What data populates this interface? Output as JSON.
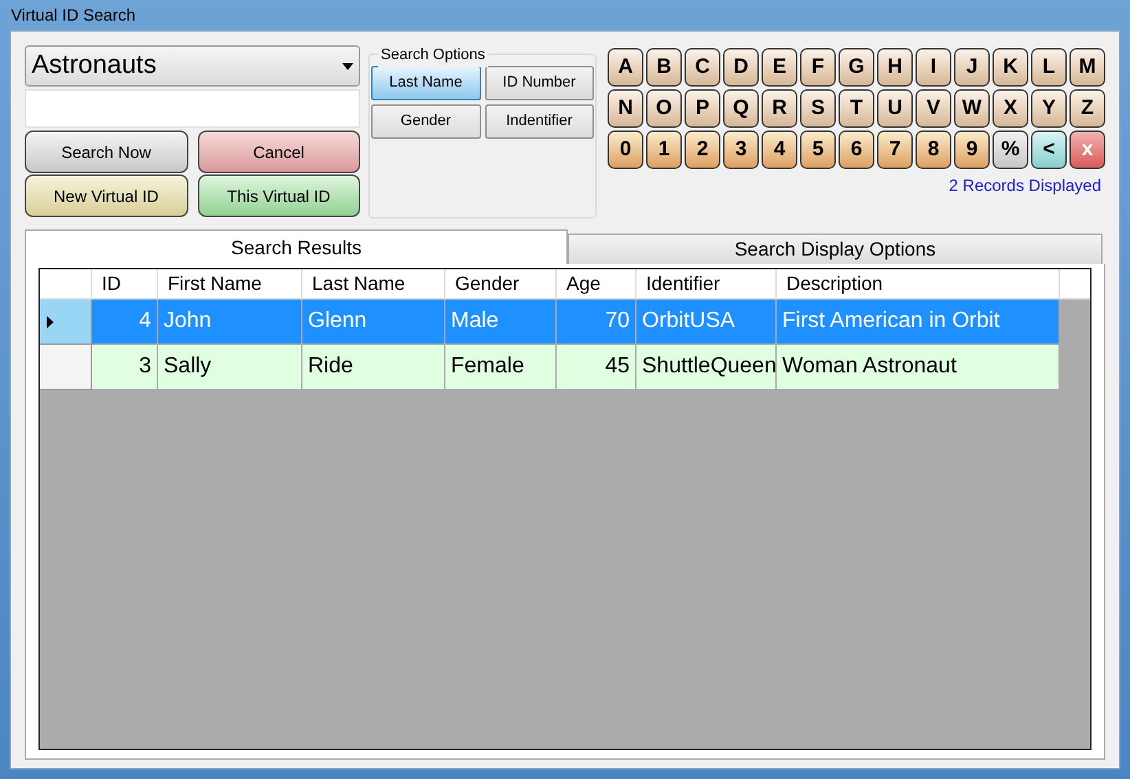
{
  "window": {
    "title": "Virtual ID Search"
  },
  "group": {
    "value": "Astronauts"
  },
  "actions": [
    {
      "label": "Search Now",
      "kind": "gray"
    },
    {
      "label": "Cancel",
      "kind": "red"
    },
    {
      "label": "New Virtual ID",
      "kind": "yellow"
    },
    {
      "label": "This Virtual ID",
      "kind": "green"
    }
  ],
  "search_options": {
    "title": "Search Options",
    "options": [
      {
        "label": "Last Name",
        "selected": true
      },
      {
        "label": "ID Number",
        "selected": false
      },
      {
        "label": "Gender",
        "selected": false
      },
      {
        "label": "Indentifier",
        "selected": false
      }
    ]
  },
  "keypad": [
    {
      "label": "A",
      "kind": "letter"
    },
    {
      "label": "B",
      "kind": "letter"
    },
    {
      "label": "C",
      "kind": "letter"
    },
    {
      "label": "D",
      "kind": "letter"
    },
    {
      "label": "E",
      "kind": "letter"
    },
    {
      "label": "F",
      "kind": "letter"
    },
    {
      "label": "G",
      "kind": "letter"
    },
    {
      "label": "H",
      "kind": "letter"
    },
    {
      "label": "I",
      "kind": "letter"
    },
    {
      "label": "J",
      "kind": "letter"
    },
    {
      "label": "K",
      "kind": "letter"
    },
    {
      "label": "L",
      "kind": "letter"
    },
    {
      "label": "M",
      "kind": "letter"
    },
    {
      "label": "N",
      "kind": "letter"
    },
    {
      "label": "O",
      "kind": "letter"
    },
    {
      "label": "P",
      "kind": "letter"
    },
    {
      "label": "Q",
      "kind": "letter"
    },
    {
      "label": "R",
      "kind": "letter"
    },
    {
      "label": "S",
      "kind": "letter"
    },
    {
      "label": "T",
      "kind": "letter"
    },
    {
      "label": "U",
      "kind": "letter"
    },
    {
      "label": "V",
      "kind": "letter"
    },
    {
      "label": "W",
      "kind": "letter"
    },
    {
      "label": "X",
      "kind": "letter"
    },
    {
      "label": "Y",
      "kind": "letter"
    },
    {
      "label": "Z",
      "kind": "letter"
    },
    {
      "label": "0",
      "kind": "digit"
    },
    {
      "label": "1",
      "kind": "digit"
    },
    {
      "label": "2",
      "kind": "digit"
    },
    {
      "label": "3",
      "kind": "digit"
    },
    {
      "label": "4",
      "kind": "digit"
    },
    {
      "label": "5",
      "kind": "digit"
    },
    {
      "label": "6",
      "kind": "digit"
    },
    {
      "label": "7",
      "kind": "digit"
    },
    {
      "label": "8",
      "kind": "digit"
    },
    {
      "label": "9",
      "kind": "digit"
    },
    {
      "label": "%",
      "kind": "wildcard"
    },
    {
      "label": "<",
      "kind": "backspace"
    },
    {
      "label": "x",
      "kind": "clear"
    }
  ],
  "record_count": "2 Records Displayed",
  "tabs": [
    {
      "label": "Search Results",
      "selected": true
    },
    {
      "label": "Search Display Options",
      "selected": false
    }
  ],
  "table": {
    "columns": [
      "ID",
      "First Name",
      "Last Name",
      "Gender",
      "Age",
      "Identifier",
      "Description"
    ],
    "rows": [
      {
        "selected": true,
        "cells": [
          "4",
          "John",
          "Glenn",
          "Male",
          "70",
          "OrbitUSA",
          "First American in Orbit"
        ]
      },
      {
        "selected": false,
        "cells": [
          "3",
          "Sally",
          "Ride",
          "Female",
          "45",
          "ShuttleQueen",
          "Woman Astronaut"
        ]
      }
    ]
  }
}
